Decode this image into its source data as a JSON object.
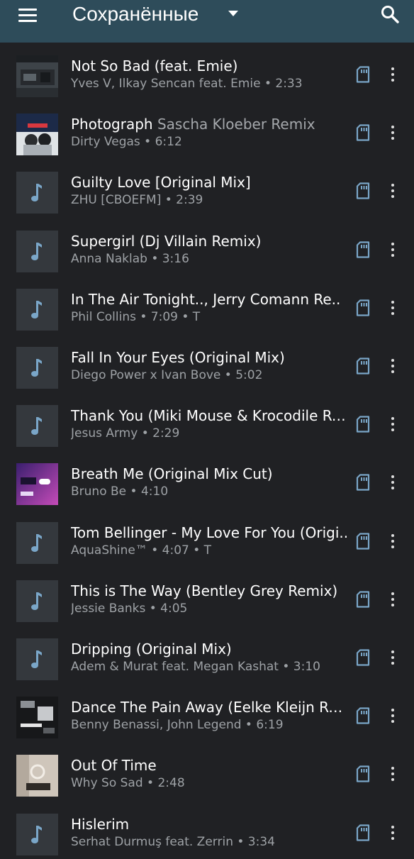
{
  "header": {
    "title": "Сохранённые",
    "background": "#2e4c5a",
    "icons": [
      "menu-icon",
      "chevron-down-icon",
      "search-icon"
    ]
  },
  "colors": {
    "background": "#202124",
    "accent": "#7aa6c8",
    "title_text": "#ffffff",
    "subtitle_text": "#9ea2a6"
  },
  "tracks": [
    {
      "title": "Not So Bad (feat. Emie)",
      "version": "",
      "subtitle": "Yves V, Ilkay Sencan feat. Emie • 2:33",
      "thumb": "art-not-so-bad"
    },
    {
      "title": "Photograph",
      "version": "Sascha Kloeber Remix",
      "subtitle": "Dirty Vegas • 6:12",
      "thumb": "art-photograph"
    },
    {
      "title": "Guilty Love [Original Mix]",
      "version": "",
      "subtitle": "ZHU [CBOEFM]  • 2:39",
      "thumb": "music-note-icon"
    },
    {
      "title": "Supergirl (Dj Villain Remix)",
      "version": "",
      "subtitle": "Anna Naklab • 3:16",
      "thumb": "music-note-icon"
    },
    {
      "title": "In The Air Tonight.., Jerry Comann Re..",
      "version": "",
      "subtitle": "Phil Collins • 7:09 • T",
      "thumb": "music-note-icon"
    },
    {
      "title": "Fall In Your Eyes (Original Mix)",
      "version": "",
      "subtitle": "Diego Power x Ivan Bove • 5:02",
      "thumb": "music-note-icon"
    },
    {
      "title": "Thank You (Miki Mouse & Krocodile Re..",
      "version": "",
      "subtitle": "Jesus Army • 2:29",
      "thumb": "music-note-icon"
    },
    {
      "title": "Breath Me (Original Mix Cut)",
      "version": "",
      "subtitle": "Bruno Be • 4:10",
      "thumb": "art-breath-me"
    },
    {
      "title": "Tom Bellinger - My Love For You (Origi..",
      "version": "",
      "subtitle": "AquaShine™ • 4:07 • T",
      "thumb": "music-note-icon"
    },
    {
      "title": "This is The Way (Bentley Grey Remix)",
      "version": "",
      "subtitle": "Jessie Banks  • 4:05",
      "thumb": "music-note-icon"
    },
    {
      "title": "Dripping (Original Mix)",
      "version": "",
      "subtitle": "Adem & Murat feat. Megan Kashat • 3:10",
      "thumb": "music-note-icon"
    },
    {
      "title": "Dance The Pain Away (Eelke Kleijn Rem..",
      "version": "",
      "subtitle": "Benny Benassi, John Legend • 6:19",
      "thumb": "art-dance-the-pain-away"
    },
    {
      "title": "Out Of Time",
      "version": "",
      "subtitle": "Why So Sad • 2:48",
      "thumb": "art-out-of-time"
    },
    {
      "title": "Hislerim",
      "version": "",
      "subtitle": "Serhat Durmuş feat. Zerrin • 3:34",
      "thumb": "music-note-icon"
    }
  ],
  "row_icons": [
    "sd-card-icon",
    "more-vert-icon"
  ]
}
